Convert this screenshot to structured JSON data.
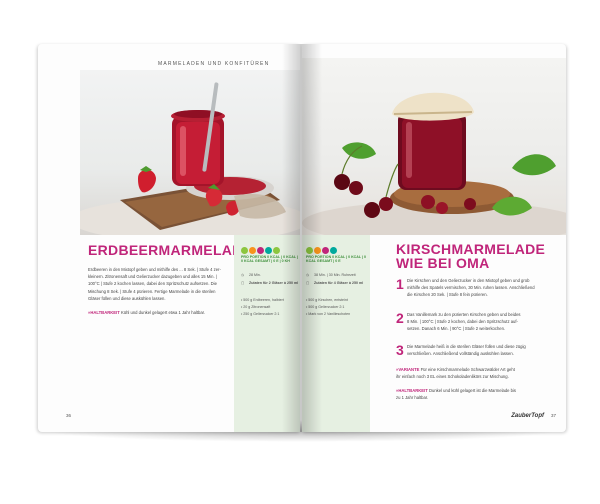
{
  "left_page": {
    "running_head": "MARMELADEN UND KONFITÜREN",
    "title": "ERDBEERMARMELADE",
    "body_lines": [
      "Erdbeeren in den Mixtopf geben und mithilfe des ... 8 Sek. | Stufe 4 zer-",
      "kleinern. Zitronensaft und Gelierzucker dazugeben und alles 15 Min. |",
      "100°C | Stufe 2 kochen lassen, dabei den Spritzschutz aufsetzen. Die",
      "Mischung 8 Sek. | Stufe 4 pürieren. Fertige Marmelade in die sterilen",
      "Gläser füllen und diese auskühlen lassen."
    ],
    "note_label": "»HALTBARKEIT",
    "note_text": "Kühl und dunkel gelagert etwa 1 Jahr haltbar.",
    "page_number": "36",
    "sidebar": {
      "head": "PRO PORTION 0 KCAL | 0 KCAL | 0 KCAL GESAMT | 0 E | 0 KH",
      "time": "28 Min.",
      "yield": "Zutaten für 2 Gläser à 250 ml",
      "ingredients": [
        "500 g Erdbeeren, halbiert",
        "20 g Zitronensaft",
        "250 g Gelierzucker 2:1"
      ]
    },
    "icon_colors": [
      "#8cc63f",
      "#f7941d",
      "#c0257a",
      "#00a99d",
      "#8cc63f"
    ]
  },
  "right_page": {
    "title_line1": "KIRSCHMARMELADE",
    "title_line2": "WIE BEI OMA",
    "steps": [
      {
        "num": "1",
        "lines": [
          "Die Kirschen und den Gelierzucker in den Mixtopf geben und grob",
          "mithilfe des Spatels vermischen, 30 Min. ruhen lassen. Anschließend",
          "die Kirschen 20 Sek. | Stufe 8 fein pürieren."
        ]
      },
      {
        "num": "2",
        "lines": [
          "Das Vanillemark zu den pürierten Kirschen geben und beides",
          "8 Min. | 100°C | Stufe 2 kochen, dabei den Spritzschutz auf-",
          "setzen. Danach 6 Min. | 90°C | Stufe 2 weiterkochen."
        ]
      },
      {
        "num": "3",
        "lines": [
          "Die Marmelade heiß in die sterilen Gläser füllen und diese zügig",
          "verschließen. Anschließend vollständig auskühlen lassen."
        ]
      }
    ],
    "variant_label": "»VARIANTE",
    "variant_lines": [
      "Für eine Kirschmarmelade Schwarzwälder Art geht",
      "ihr einfach noch 3 EL eines Schokoladenlikörs zur Mischung."
    ],
    "note_label": "»HALTBARKEIT",
    "note_lines": [
      "Dunkel und kühl gelagert ist die Marmelade bis",
      "zu 1 Jahr haltbar."
    ],
    "page_number": "37",
    "logo": "ZauberTopf",
    "sidebar": {
      "head": "PRO PORTION 0 KCAL | 0 KCAL | 0 KCAL GESAMT | 0 E",
      "time": "38 Min. | 30 Min. Ruhezeit",
      "yield": "Zutaten für 4 Gläser à 250 ml",
      "ingredients": [
        "500 g Kirschen, entsteint",
        "500 g Gelierzucker 2:1",
        "Mark von 2 Vanilleschoten"
      ]
    },
    "icon_colors": [
      "#8cc63f",
      "#f7941d",
      "#c0257a",
      "#00a99d"
    ]
  }
}
